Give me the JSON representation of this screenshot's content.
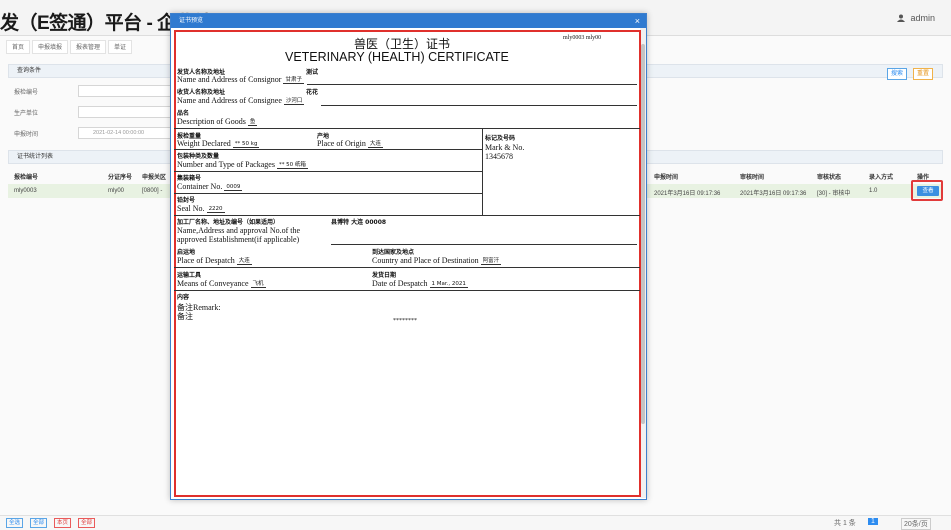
{
  "header": {
    "brand": "发（E签通）平台 - 企业端",
    "user": "admin"
  },
  "tabs": [
    "首页",
    "申报填报",
    "报表管理",
    "单证"
  ],
  "query": {
    "section": "查询条件",
    "fields": [
      {
        "label": "报检编号"
      },
      {
        "label": "生产单位"
      },
      {
        "label": "申报时间",
        "value": "2021-02-14 00:00:00"
      }
    ],
    "search_label": "搜索",
    "reset_label": "重置"
  },
  "list": {
    "section": "证书统计列表",
    "left_cols": [
      "报检编号",
      "分证序号",
      "申报关区"
    ],
    "right_cols": [
      "申报时间",
      "审核时间",
      "审核状态",
      "录入方式",
      "操作"
    ],
    "row": {
      "no": "mly0003",
      "seq": "mly00",
      "area": "[0800] -",
      "declared": "2021年3月16日 09:17:36",
      "reviewed": "2021年3月16日 09:17:36",
      "status": "[30] - 审核中",
      "mode": "1.0",
      "view": "查看"
    }
  },
  "footer": {
    "buttons": [
      "全选",
      "全部",
      "本页",
      "全部"
    ],
    "page_text": "共 1 条",
    "page_num": "1",
    "per_page": "20条/页"
  },
  "modal": {
    "title": "证书预览",
    "close": "×"
  },
  "cert": {
    "no": "mly0003 mly00",
    "title_zh": "兽医（卫生）证书",
    "title_en": "VETERINARY (HEALTH) CERTIFICATE",
    "consignor_zh": "发货人名称及地址",
    "consignor_en": "Name and Address of Consignor",
    "consignor_val_top": "测试",
    "consignor_val": "甘肃子",
    "consignee_zh": "收货人名称及地址",
    "consignee_en": "Name and Address of Consignee",
    "consignee_val_top": "花花",
    "consignee_val": "沙河口",
    "goods_zh": "品名",
    "goods_en": "Description of Goods",
    "goods_val": "鱼",
    "weight_zh": "报检重量",
    "weight_en": "Weight Declared",
    "weight_val": "** 50 kg",
    "origin_zh": "产地",
    "origin_en": "Place of Origin",
    "origin_val": "大连",
    "mark_zh": "标记及号码",
    "mark_en": "Mark & No.",
    "mark_val": "1345678",
    "packages_zh": "包装种类及数量",
    "packages_en": "Number and Type of Packages",
    "packages_val": "** 50 纸箱",
    "container_zh": "集装箱号",
    "container_en": "Container No.",
    "container_val": "0009",
    "seal_zh": "铅封号",
    "seal_en": "Seal No.",
    "seal_val": "2220",
    "estab_zh": "加工厂名称、地址及编号（如果适用）",
    "estab_val": "县博特 大连 00008",
    "estab_en1": "Name,Address and approval No.of the",
    "estab_en2": "approved Establishment(if applicable)",
    "despatch_zh": "启运地",
    "despatch_en": "Place of Despatch",
    "despatch_val": "大连",
    "dest_zh": "到达国家及地点",
    "dest_en": "Country and Place of Destination",
    "dest_val": "阿富汗",
    "conv_zh": "运输工具",
    "conv_en": "Means of Conveyance",
    "conv_val": "飞机",
    "date_zh": "发货日期",
    "date_en": "Date of Despatch",
    "date_val": "1 Mar., 2021",
    "content_zh": "内容",
    "remark_en": "备注Remark:",
    "remark_zh": "备注",
    "stars": "********"
  }
}
